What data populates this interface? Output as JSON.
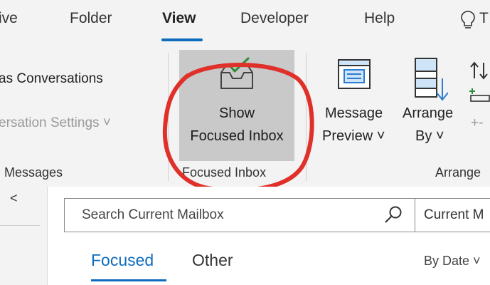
{
  "tabs": [
    {
      "label": "ive"
    },
    {
      "label": "Folder"
    },
    {
      "label": "View"
    },
    {
      "label": "Developer"
    },
    {
      "label": "Help"
    },
    {
      "label": "T"
    }
  ],
  "ribbon": {
    "conversations": "as Conversations",
    "conversation_settings": "ersation Settings ˅",
    "messages_group": "Messages",
    "show_focused_line1": "Show",
    "show_focused_line2": "Focused Inbox",
    "focused_group": "Focused Inbox",
    "message_preview_line1": "Message",
    "message_preview_line2": "Preview ˅",
    "arrange_by_line1": "Arrange",
    "arrange_by_line2": "By ˅",
    "arrange_group": "Arrange",
    "partial_minus": "+-"
  },
  "mailbox": {
    "search_placeholder": "Search Current Mailbox",
    "scope": "Current M",
    "focused_tab": "Focused",
    "other_tab": "Other",
    "sort": "By Date ˅",
    "collapse": "<"
  },
  "colors": {
    "accent": "#0f6cbd",
    "annotation": "#e0302a",
    "selected_button": "#c9c9c9"
  }
}
